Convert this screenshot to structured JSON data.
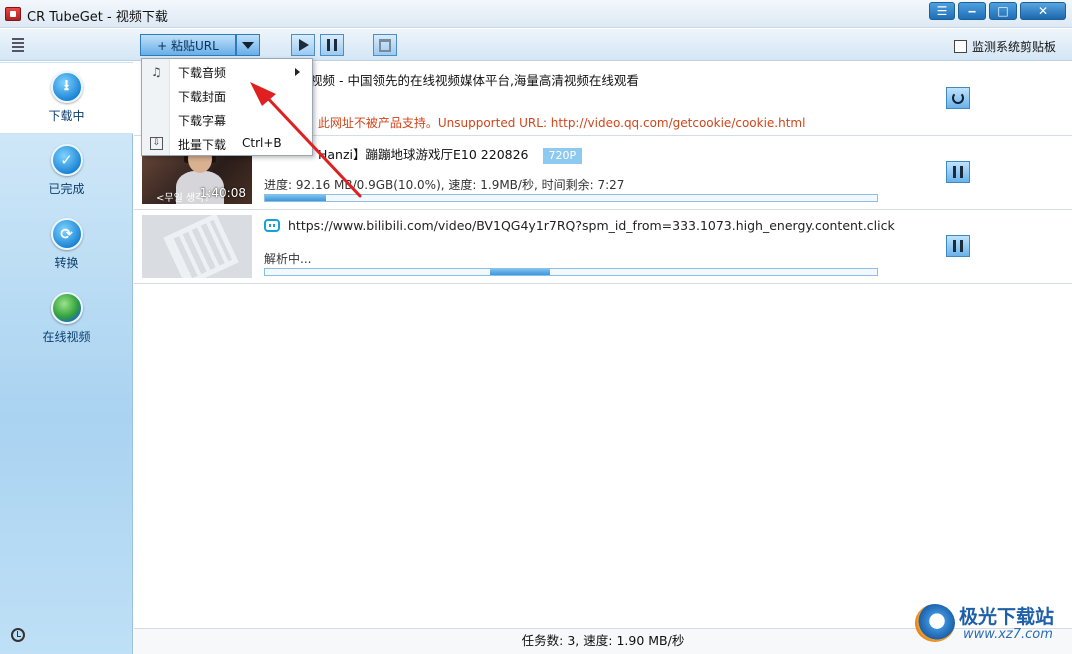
{
  "window": {
    "title": "CR TubeGet - 视频下载",
    "buttons": [
      "menu",
      "minimize",
      "maximize",
      "close"
    ]
  },
  "toolbar": {
    "paste_label": "+ 粘贴URL",
    "monitor_label": "监测系统剪贴板",
    "monitor_checked": false
  },
  "sidebar": {
    "items": [
      {
        "label": "下载中",
        "icon": "download-icon",
        "active": true
      },
      {
        "label": "已完成",
        "icon": "check-icon",
        "active": false
      },
      {
        "label": "转换",
        "icon": "convert-icon",
        "active": false
      },
      {
        "label": "在线视频",
        "icon": "globe-icon",
        "active": false
      }
    ]
  },
  "dropdown": {
    "items": [
      {
        "label": "下载音频",
        "icon": "music-note-icon",
        "has_submenu": true
      },
      {
        "label": "下载封面"
      },
      {
        "label": "下载字幕"
      },
      {
        "label": "批量下载",
        "icon": "batch-download-icon",
        "shortcut": "Ctrl+B"
      }
    ]
  },
  "downloads": [
    {
      "title": "视频 - 中国领先的在线视频媒体平台,海量高清视频在线观看",
      "error": ": 此网址不被产品支持。Unsupported URL: http://video.qq.com/getcookie/cookie.html",
      "action": "refresh-icon"
    },
    {
      "title": "Hanzi】蹦蹦地球游戏厅E10 220826",
      "quality": "720P",
      "thumb_overlay": "<무일 생각?",
      "duration": "1:40:08",
      "progress_text": "进度: 92.16 MB/0.9GB(10.0%), 速度: 1.9MB/秒, 时间剩余: 7:27",
      "progress_pct": 10,
      "action": "pause-icon"
    },
    {
      "url": "https://www.bilibili.com/video/BV1QG4y1r7RQ?spm_id_from=333.1073.high_energy.content.click",
      "status": "解析中...",
      "action": "pause-icon"
    }
  ],
  "status": {
    "text": "任务数: 3, 速度: 1.90 MB/秒"
  },
  "watermark": {
    "name": "极光下载站",
    "url": "www.xz7.com"
  },
  "colors": {
    "accent": "#1d6eb6",
    "error": "#d0451b",
    "annotation_arrow": "#e02020",
    "badge": "#8ec9ef"
  }
}
